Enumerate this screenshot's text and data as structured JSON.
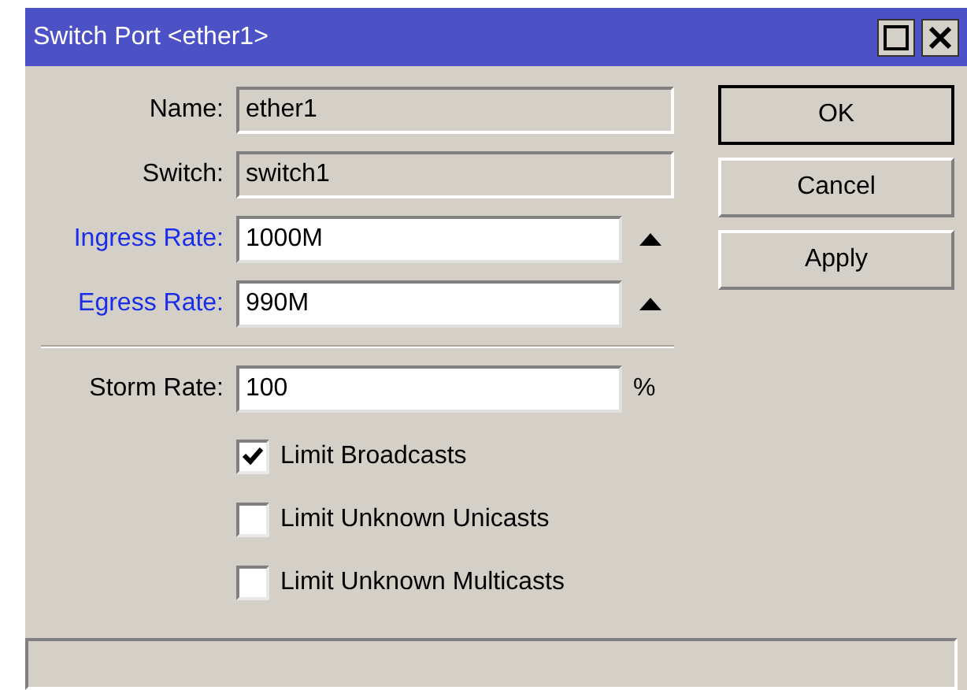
{
  "window": {
    "title": "Switch Port <ether1>"
  },
  "fields": [
    {
      "kind": "readonly",
      "label": "Name:",
      "value": "ether1"
    },
    {
      "kind": "readonly",
      "label": "Switch:",
      "value": "switch1"
    },
    {
      "kind": "rate",
      "label": "Ingress Rate:",
      "value": "1000M"
    },
    {
      "kind": "rate",
      "label": "Egress Rate:",
      "value": "990M"
    }
  ],
  "storm": {
    "label": "Storm Rate:",
    "value": "100",
    "unit": "%"
  },
  "checkboxes": [
    {
      "label": "Limit Broadcasts",
      "checked": true
    },
    {
      "label": "Limit Unknown Unicasts",
      "checked": false
    },
    {
      "label": "Limit Unknown Multicasts",
      "checked": false
    }
  ],
  "buttons": [
    "OK",
    "Cancel",
    "Apply"
  ]
}
